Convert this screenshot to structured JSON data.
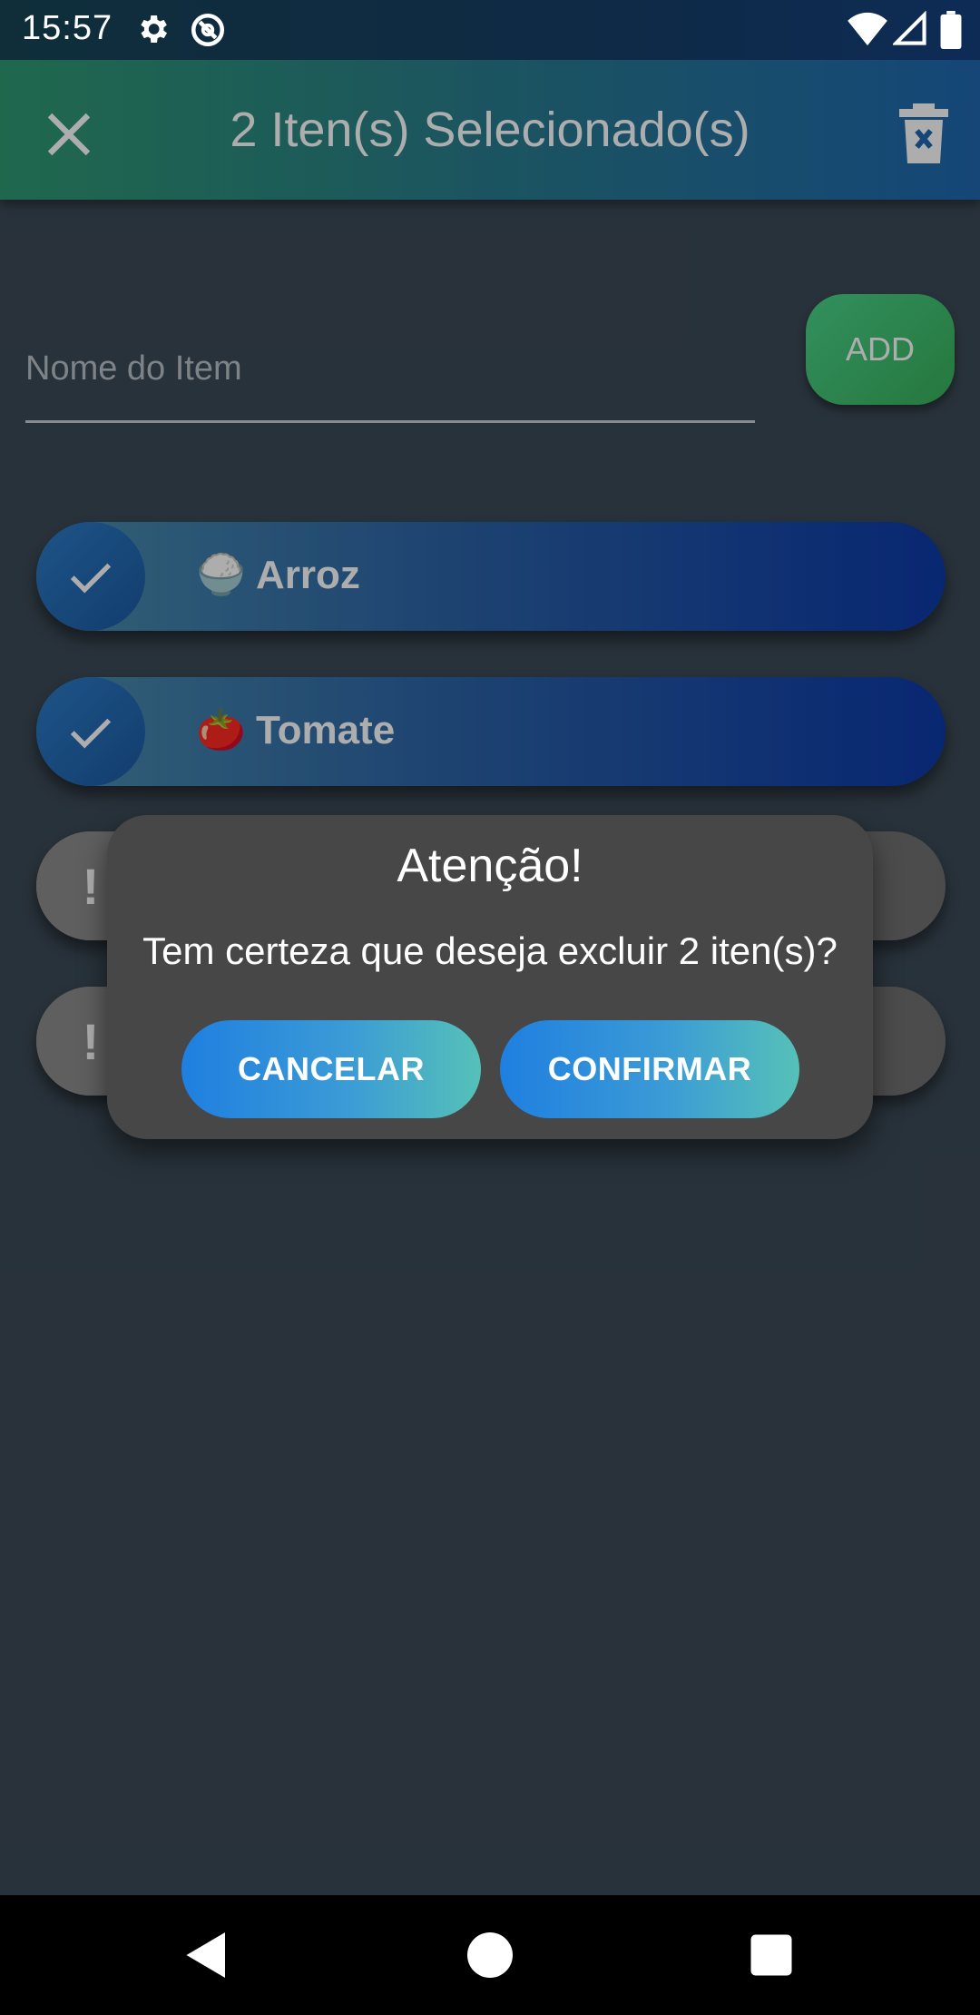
{
  "status_bar": {
    "time": "15:57",
    "icons": [
      "gear-icon",
      "vpn-icon",
      "wifi-icon",
      "cellular-icon",
      "battery-icon"
    ]
  },
  "app_bar": {
    "title": "2 Iten(s) Selecionado(s)",
    "close_icon": "close-icon",
    "delete_icon": "delete-icon"
  },
  "input": {
    "placeholder": "Nome do Item",
    "value": "",
    "add_label": "ADD"
  },
  "items": [
    {
      "emoji": "🍚",
      "label": "Arroz",
      "selected": true,
      "badge": "check-icon"
    },
    {
      "emoji": "🍅",
      "label": "Tomate",
      "selected": true,
      "badge": "check-icon"
    },
    {
      "label": "",
      "selected": false,
      "badge": "!"
    },
    {
      "label": "",
      "selected": false,
      "badge": "!"
    }
  ],
  "dialog": {
    "title": "Atenção!",
    "message": "Tem certeza que deseja excluir 2 iten(s)?",
    "cancel_label": "CANCELAR",
    "confirm_label": "CONFIRMAR"
  },
  "colors": {
    "background": "#3c4a56",
    "app_bar_start": "#2f9a72",
    "app_bar_end": "#1f68b0",
    "add_button": "#38b05a",
    "dialog_bg": "#474747",
    "button_start": "#1f7fe0",
    "button_end": "#55c1b8"
  }
}
